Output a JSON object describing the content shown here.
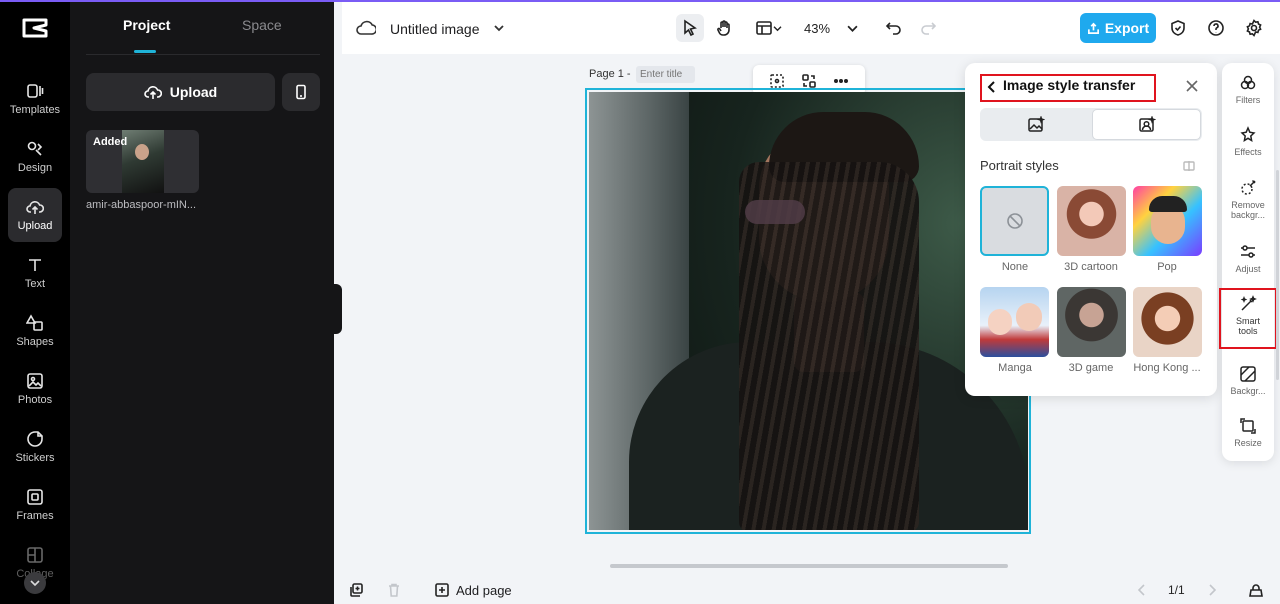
{
  "left_rail": {
    "logo": "capcut-logo",
    "items": [
      {
        "label": "Templates",
        "icon": "templates-icon"
      },
      {
        "label": "Design",
        "icon": "design-icon"
      },
      {
        "label": "Upload",
        "icon": "upload-cloud-icon",
        "active": true
      },
      {
        "label": "Text",
        "icon": "text-icon"
      },
      {
        "label": "Shapes",
        "icon": "shapes-icon"
      },
      {
        "label": "Photos",
        "icon": "photos-icon"
      },
      {
        "label": "Stickers",
        "icon": "stickers-icon"
      },
      {
        "label": "Frames",
        "icon": "frames-icon"
      },
      {
        "label": "Collage",
        "icon": "collage-icon"
      }
    ]
  },
  "panel": {
    "tabs": [
      "Project",
      "Space"
    ],
    "upload_label": "Upload",
    "asset": {
      "badge": "Added",
      "name": "amir-abbaspoor-mIN..."
    }
  },
  "topbar": {
    "doc_title": "Untitled image",
    "zoom": "43%",
    "export_label": "Export"
  },
  "canvas": {
    "page_label": "Page 1 -",
    "title_placeholder": "Enter title"
  },
  "bottombar": {
    "add_page_label": "Add page",
    "page_counter": "1/1"
  },
  "style_panel": {
    "title": "Image style transfer",
    "section": "Portrait styles",
    "styles": [
      {
        "label": "None"
      },
      {
        "label": "3D cartoon"
      },
      {
        "label": "Pop"
      },
      {
        "label": "Manga"
      },
      {
        "label": "3D game"
      },
      {
        "label": "Hong Kong ..."
      }
    ]
  },
  "tool_rail": {
    "items": [
      {
        "label": "Filters",
        "icon": "filters-icon"
      },
      {
        "label": "Effects",
        "icon": "effects-icon"
      },
      {
        "label": "Remove backgr...",
        "icon": "remove-background-icon"
      },
      {
        "label": "Adjust",
        "icon": "adjust-icon"
      },
      {
        "label": "Smart tools",
        "icon": "smart-tools-icon",
        "active": true
      },
      {
        "label": "Backgr...",
        "icon": "background-icon"
      },
      {
        "label": "Resize",
        "icon": "resize-icon"
      }
    ]
  },
  "colors": {
    "accent": "#1fb3d8",
    "export": "#1fa9ee",
    "highlight": "#e0141e"
  }
}
